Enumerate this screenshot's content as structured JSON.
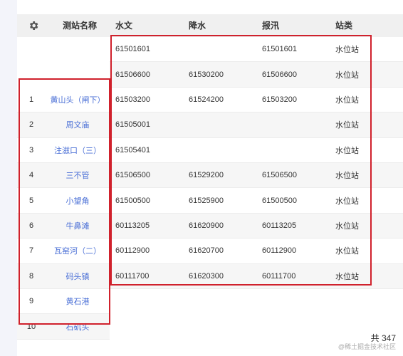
{
  "table": {
    "header": {
      "settings_icon": "gear-icon",
      "station_name": "测站名称",
      "hydrology": "水文",
      "rainfall": "降水",
      "report": "报汛",
      "station_type": "站类"
    },
    "rows": [
      {
        "index": "",
        "name": "",
        "hydrology": "61501601",
        "rainfall": "",
        "report": "61501601",
        "type": "水位站"
      },
      {
        "index": "",
        "name": "",
        "hydrology": "61506600",
        "rainfall": "61530200",
        "report": "61506600",
        "type": "水位站"
      },
      {
        "index": "1",
        "name": "黄山头（闸下）",
        "hydrology": "61503200",
        "rainfall": "61524200",
        "report": "61503200",
        "type": "水位站"
      },
      {
        "index": "2",
        "name": "周文庙",
        "hydrology": "61505001",
        "rainfall": "",
        "report": "",
        "type": "水位站"
      },
      {
        "index": "3",
        "name": "注滋口（三）",
        "hydrology": "61505401",
        "rainfall": "",
        "report": "",
        "type": "水位站"
      },
      {
        "index": "4",
        "name": "三不管",
        "hydrology": "61506500",
        "rainfall": "61529200",
        "report": "61506500",
        "type": "水位站"
      },
      {
        "index": "5",
        "name": "小望角",
        "hydrology": "61500500",
        "rainfall": "61525900",
        "report": "61500500",
        "type": "水位站"
      },
      {
        "index": "6",
        "name": "牛鼻滩",
        "hydrology": "60113205",
        "rainfall": "61620900",
        "report": "60113205",
        "type": "水位站"
      },
      {
        "index": "7",
        "name": "瓦窑河（二）",
        "hydrology": "60112900",
        "rainfall": "61620700",
        "report": "60112900",
        "type": "水位站"
      },
      {
        "index": "8",
        "name": "码头镇",
        "hydrology": "60111700",
        "rainfall": "61620300",
        "report": "60111700",
        "type": "水位站"
      },
      {
        "index": "9",
        "name": "黄石港",
        "hydrology": "",
        "rainfall": "",
        "report": "",
        "type": ""
      },
      {
        "index": "10",
        "name": "石矶头",
        "hydrology": "",
        "rainfall": "",
        "report": "",
        "type": ""
      }
    ],
    "total": "共 347"
  },
  "watermark": "@稀土掘金技术社区",
  "colors": {
    "highlight": "#d0212c",
    "link": "#4a6fd6"
  }
}
